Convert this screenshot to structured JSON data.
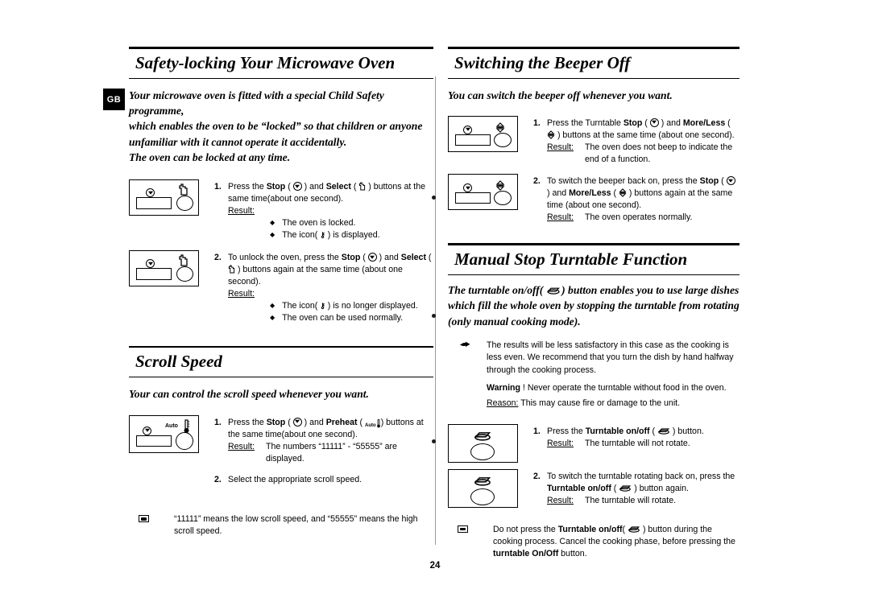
{
  "page": {
    "number": "24",
    "locale_badge": "GB"
  },
  "left_column": {
    "section1": {
      "heading": "Safety-locking Your Microwave Oven",
      "intro_lines": [
        "Your microwave oven is fitted with a special Child Safety programme,",
        "which enables the oven to be “locked” so that children or anyone",
        "unfamiliar with it cannot operate it accidentally.",
        "The oven can be locked at any time."
      ],
      "steps": [
        {
          "number": "1.",
          "text_before": "Press the ",
          "bold1": "Stop",
          "mid1": " ( ",
          "icon1": "stop-icon",
          "mid2": " ) and ",
          "bold2": "Select",
          "mid3": " ( ",
          "icon2": "select-hand-icon",
          "tail": " ) buttons at the same time(about one second).",
          "result_label": "Result:",
          "bullets": [
            "The oven is locked.",
            "The icon(  ) is displayed."
          ]
        },
        {
          "number": "2.",
          "text_before": "To unlock the oven, press the ",
          "bold1": "Stop",
          "mid1": " ( ",
          "icon1": "stop-icon",
          "mid2": " ) and ",
          "bold2": "Select",
          "mid3": " ( ",
          "icon2": "select-hand-icon",
          "tail": " ) buttons again at the same time (about one second).",
          "result_label": "Result:",
          "bullets": [
            "The icon(  ) is no longer displayed.",
            "The oven can be used normally."
          ]
        }
      ]
    },
    "section2": {
      "heading": "Scroll Speed",
      "intro_lines": [
        "Your can control the scroll speed whenever you want."
      ],
      "step1": {
        "number": "1.",
        "text_before": "Press the ",
        "bold1": "Stop",
        "mid1": " ( ",
        "icon1": "stop-icon",
        "mid2": " ) and ",
        "bold2": "Preheat",
        "mid3": " ( ",
        "icon2": "preheat-auto-icon",
        "tail": ") buttons at the same time(about one second).",
        "result_label": "Result:",
        "result_value": "The numbers “11111” - “55555” are displayed."
      },
      "step2": {
        "number": "2.",
        "text": "Select the appropriate scroll speed."
      },
      "note": {
        "icon": "note-box-icon",
        "text": "“11111” means the low scroll speed, and “55555” means the high scroll speed."
      }
    }
  },
  "right_column": {
    "section1": {
      "heading": "Switching the Beeper Off",
      "intro_lines": [
        "You can switch the beeper off whenever you want."
      ],
      "steps": [
        {
          "number": "1.",
          "text_before": "Press the Turntable ",
          "bold1": "Stop",
          "mid1": " ( ",
          "icon1": "stop-icon",
          "mid2": " ) and ",
          "bold2": "More/Less",
          "mid3": " ( ",
          "icon2": "more-less-icon",
          "tail": " ) buttons at the same time (about one second).",
          "result_label": "Result:",
          "result_value": "The oven does not beep to indicate the end of a function."
        },
        {
          "number": "2.",
          "text_before": "To switch the beeper back on, press the ",
          "bold1": "Stop",
          "mid1": " ( ",
          "icon1": "stop-icon",
          "mid2": " ) and ",
          "bold2": "More/",
          "bold2b": "Less",
          "mid3": " ( ",
          "icon2": "more-less-icon",
          "tail": " ) buttons again at the same time (about one second).",
          "result_label": "Result:",
          "result_value": "The oven operates normally."
        }
      ]
    },
    "section2": {
      "heading": "Manual Stop Turntable Function",
      "intro_before": "The turntable on/off( ",
      "intro_icon": "turntable-icon",
      "intro_after": " ) button enables you to use large dishes which fill the whole oven by stopping the turntable from rotating (only manual cooking mode).",
      "hand_note": {
        "icon": "pointing-hand-icon",
        "paragraph": "The results will be less satisfactory in this case as the cooking is less even. We recommend that you turn the dish by hand halfway through the cooking process.",
        "warning_bold": "Warning",
        "warning_rest": " ! Never operate the turntable without food in the oven.",
        "reason_label": "Reason:",
        "reason_text": " This may cause fire or damage to the unit."
      },
      "steps": [
        {
          "number": "1.",
          "text_before": "Press the ",
          "bold1": "Turntable on/off",
          "mid1": " ( ",
          "icon1": "turntable-icon",
          "tail": " ) button.",
          "result_label": "Result:",
          "result_value": "The turntable will not rotate."
        },
        {
          "number": "2.",
          "text_before": "To switch the turntable rotating back on, press the ",
          "bold1": "Turntable",
          "bold1b": "on/off",
          "mid1": " ( ",
          "icon1": "turntable-icon",
          "tail": " ) button again.",
          "result_label": "Result:",
          "result_value": "The turntable will rotate."
        }
      ],
      "note": {
        "icon": "note-box-icon",
        "text_a": "Do not press the ",
        "bold_a": "Turntable on/off",
        "text_b": "( ",
        "icon_inline": "turntable-icon",
        "text_c": " ) button during the cooking process. Cancel the cooking phase, before pressing the ",
        "bold_b": "turntable On/",
        "bold_c": "Off",
        "text_d": " button."
      }
    }
  },
  "diamond_glyph": "◆",
  "colors": {
    "ink": "#000000",
    "paper": "#ffffff",
    "rule": "#9a9a9a"
  }
}
